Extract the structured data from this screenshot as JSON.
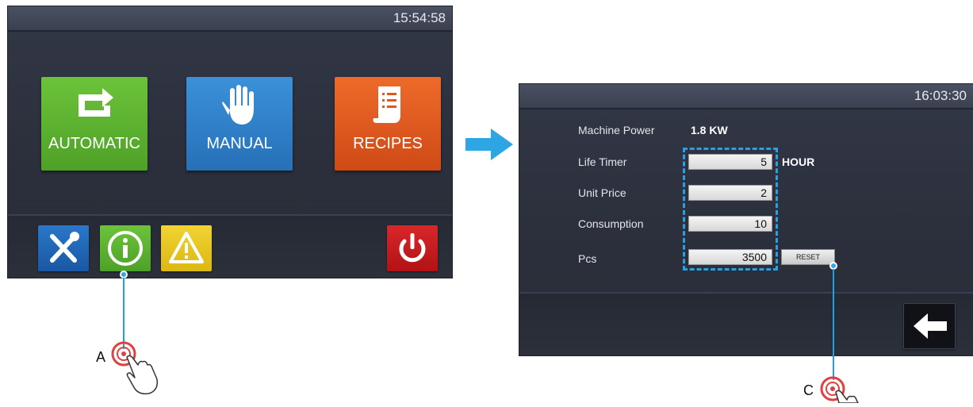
{
  "left_screen": {
    "clock": "15:54:58",
    "tiles": [
      {
        "label": "AUTOMATIC",
        "color": "#5bb12f",
        "icon": "cycle-icon"
      },
      {
        "label": "MANUAL",
        "color": "#2e7fc8",
        "icon": "hand-icon"
      },
      {
        "label": "RECIPES",
        "color": "#e0571d",
        "icon": "recipe-document-icon"
      }
    ],
    "bottom_buttons": [
      {
        "icon": "tools-icon",
        "color": "#1e63b5"
      },
      {
        "icon": "info-icon",
        "color": "#5bb12f"
      },
      {
        "icon": "warning-icon",
        "color": "#e7c51c"
      },
      {
        "icon": "power-icon",
        "color": "#c8191d"
      }
    ]
  },
  "arrow_icon": "right-arrow-icon",
  "right_screen": {
    "clock": "16:03:30",
    "machine_power": {
      "label": "Machine Power",
      "value": "1.8 KW"
    },
    "rows": [
      {
        "label": "Life Timer",
        "value": "5",
        "unit": "HOUR"
      },
      {
        "label": "Unit Price",
        "value": "2"
      },
      {
        "label": "Consumption",
        "value": "10"
      },
      {
        "label": "Pcs",
        "value": "3500"
      }
    ],
    "reset_label": "RESET",
    "back_icon": "back-arrow-icon"
  },
  "callouts": {
    "a": "A",
    "c": "C"
  },
  "accent": "#1ea0e8"
}
